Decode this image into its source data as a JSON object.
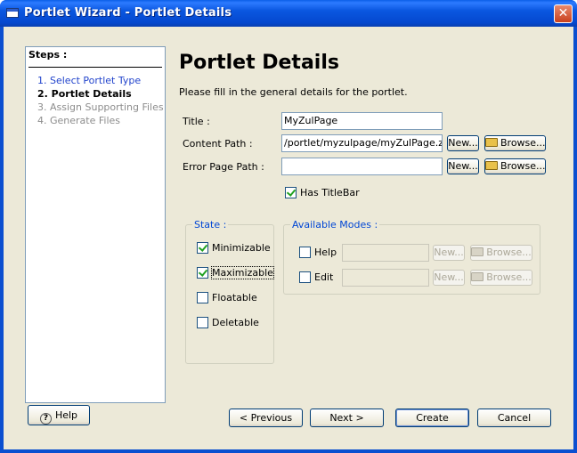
{
  "window": {
    "title": "Portlet Wizard - Portlet Details",
    "close_glyph": "✕"
  },
  "steps": {
    "title": "Steps :",
    "items": [
      {
        "label": "1. Select Portlet Type",
        "state": "link"
      },
      {
        "label": "2. Portlet Details",
        "state": "current"
      },
      {
        "label": "3. Assign Supporting Files",
        "state": "disabled"
      },
      {
        "label": "4. Generate Files",
        "state": "disabled"
      }
    ]
  },
  "main": {
    "heading": "Portlet Details",
    "subtitle": "Please fill in the general details for the portlet."
  },
  "form": {
    "title": {
      "label": "Title :",
      "value": "MyZulPage"
    },
    "content_path": {
      "label": "Content Path :",
      "value": "/portlet/myzulpage/myZulPage.zul"
    },
    "error_page_path": {
      "label": "Error Page Path :",
      "value": ""
    },
    "new_label": "New...",
    "browse_label": "Browse...",
    "has_titlebar": {
      "label": "Has TitleBar",
      "checked": true
    }
  },
  "state_group": {
    "legend": "State :",
    "options": [
      {
        "label": "Minimizable",
        "checked": true
      },
      {
        "label": "Maximizable",
        "checked": true
      },
      {
        "label": "Floatable",
        "checked": false
      },
      {
        "label": "Deletable",
        "checked": false
      }
    ]
  },
  "modes_group": {
    "legend": "Available Modes :",
    "modes": [
      {
        "label": "Help",
        "checked": false,
        "value": ""
      },
      {
        "label": "Edit",
        "checked": false,
        "value": ""
      }
    ]
  },
  "footer": {
    "help_label": "Help",
    "previous_label": "< Previous",
    "next_label": "Next >",
    "create_label": "Create",
    "cancel_label": "Cancel"
  },
  "colors": {
    "title_bar": "#0548cf",
    "dialog_bg": "#ece9d8",
    "step_link": "#2244cc",
    "group_legend": "#0046d5",
    "check_mark": "#21a121"
  }
}
